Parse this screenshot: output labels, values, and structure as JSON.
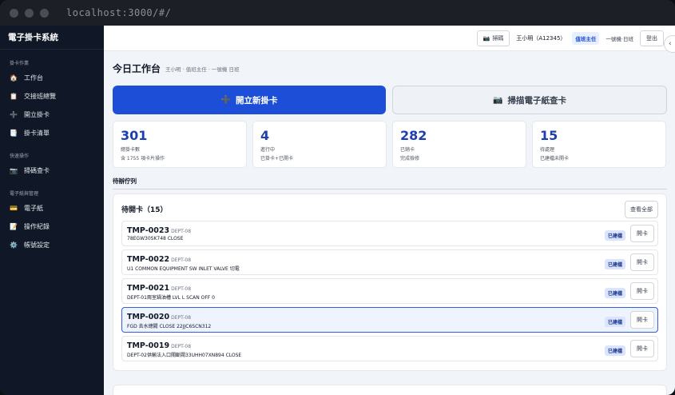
{
  "browser": {
    "url": "localhost:3000/#/"
  },
  "sidebar": {
    "brand": "電子掛卡系統",
    "sections": [
      {
        "title": "掛卡作業",
        "items": [
          {
            "icon": "home-icon",
            "glyph": "🏠",
            "label": "工作台"
          },
          {
            "icon": "clipboard-icon",
            "glyph": "📋",
            "label": "交接班總覽"
          },
          {
            "icon": "plus-icon",
            "glyph": "➕",
            "label": "開立掛卡"
          },
          {
            "icon": "document-icon",
            "glyph": "📑",
            "label": "掛卡清單"
          }
        ]
      },
      {
        "title": "快速操作",
        "items": [
          {
            "icon": "camera-icon",
            "glyph": "📷",
            "label": "掃碼查卡"
          }
        ]
      },
      {
        "title": "電子紙與管理",
        "items": [
          {
            "icon": "card-icon",
            "glyph": "💳",
            "label": "電子紙"
          },
          {
            "icon": "memo-icon",
            "glyph": "📝",
            "label": "操作紀錄"
          },
          {
            "icon": "gear-icon",
            "glyph": "⚙️",
            "label": "帳號設定"
          }
        ]
      }
    ]
  },
  "topbar": {
    "scan_label": "掃碼",
    "user": "王小明（A12345）",
    "role": "值班主任",
    "shift": "一號機·日班",
    "logout": "登出"
  },
  "page": {
    "title": "今日工作台",
    "subtitle": "王小明 · 值班主任 · 一號機 日班",
    "primary_action": "開立新掛卡",
    "secondary_action": "掃描電子紙查卡"
  },
  "stats": [
    {
      "value": "301",
      "label": "總掛卡數",
      "sub": "含 1755 項卡片操作"
    },
    {
      "value": "4",
      "label": "進行中",
      "sub": "已掛卡+已開卡"
    },
    {
      "value": "282",
      "label": "已銷卡",
      "sub": "完成檢修"
    },
    {
      "value": "15",
      "label": "待處理",
      "sub": "已建檔未開卡"
    }
  ],
  "queue": {
    "section_title": "待辦佇列",
    "panel_title": "待開卡（15）",
    "view_all": "查看全部",
    "items": [
      {
        "id": "TMP-0023",
        "dept": "DEPT-08",
        "desc": "78EGW30SK748 CLOSE",
        "status": "已建檔",
        "action": "開卡",
        "selected": false
      },
      {
        "id": "TMP-0022",
        "dept": "DEPT-08",
        "desc": "U1 COMMON EQUIPMENT SW INLET VALVE 切電",
        "status": "已建檔",
        "action": "開卡",
        "selected": false
      },
      {
        "id": "TMP-0021",
        "dept": "DEPT-08",
        "desc": "DEPT-01兩室鍋油槽 LVL L SCAN OFF 0",
        "status": "已建檔",
        "action": "開卡",
        "selected": false
      },
      {
        "id": "TMP-0020",
        "dept": "DEPT-08",
        "desc": "FGD 去水總閥 CLOSE 22JJC6SCN312",
        "status": "已建檔",
        "action": "開卡",
        "selected": true
      },
      {
        "id": "TMP-0019",
        "dept": "DEPT-08",
        "desc": "DEPT-02供輸法入口關斷閥33UHH07XN894 CLOSE",
        "status": "已建檔",
        "action": "開卡",
        "selected": false
      }
    ]
  }
}
